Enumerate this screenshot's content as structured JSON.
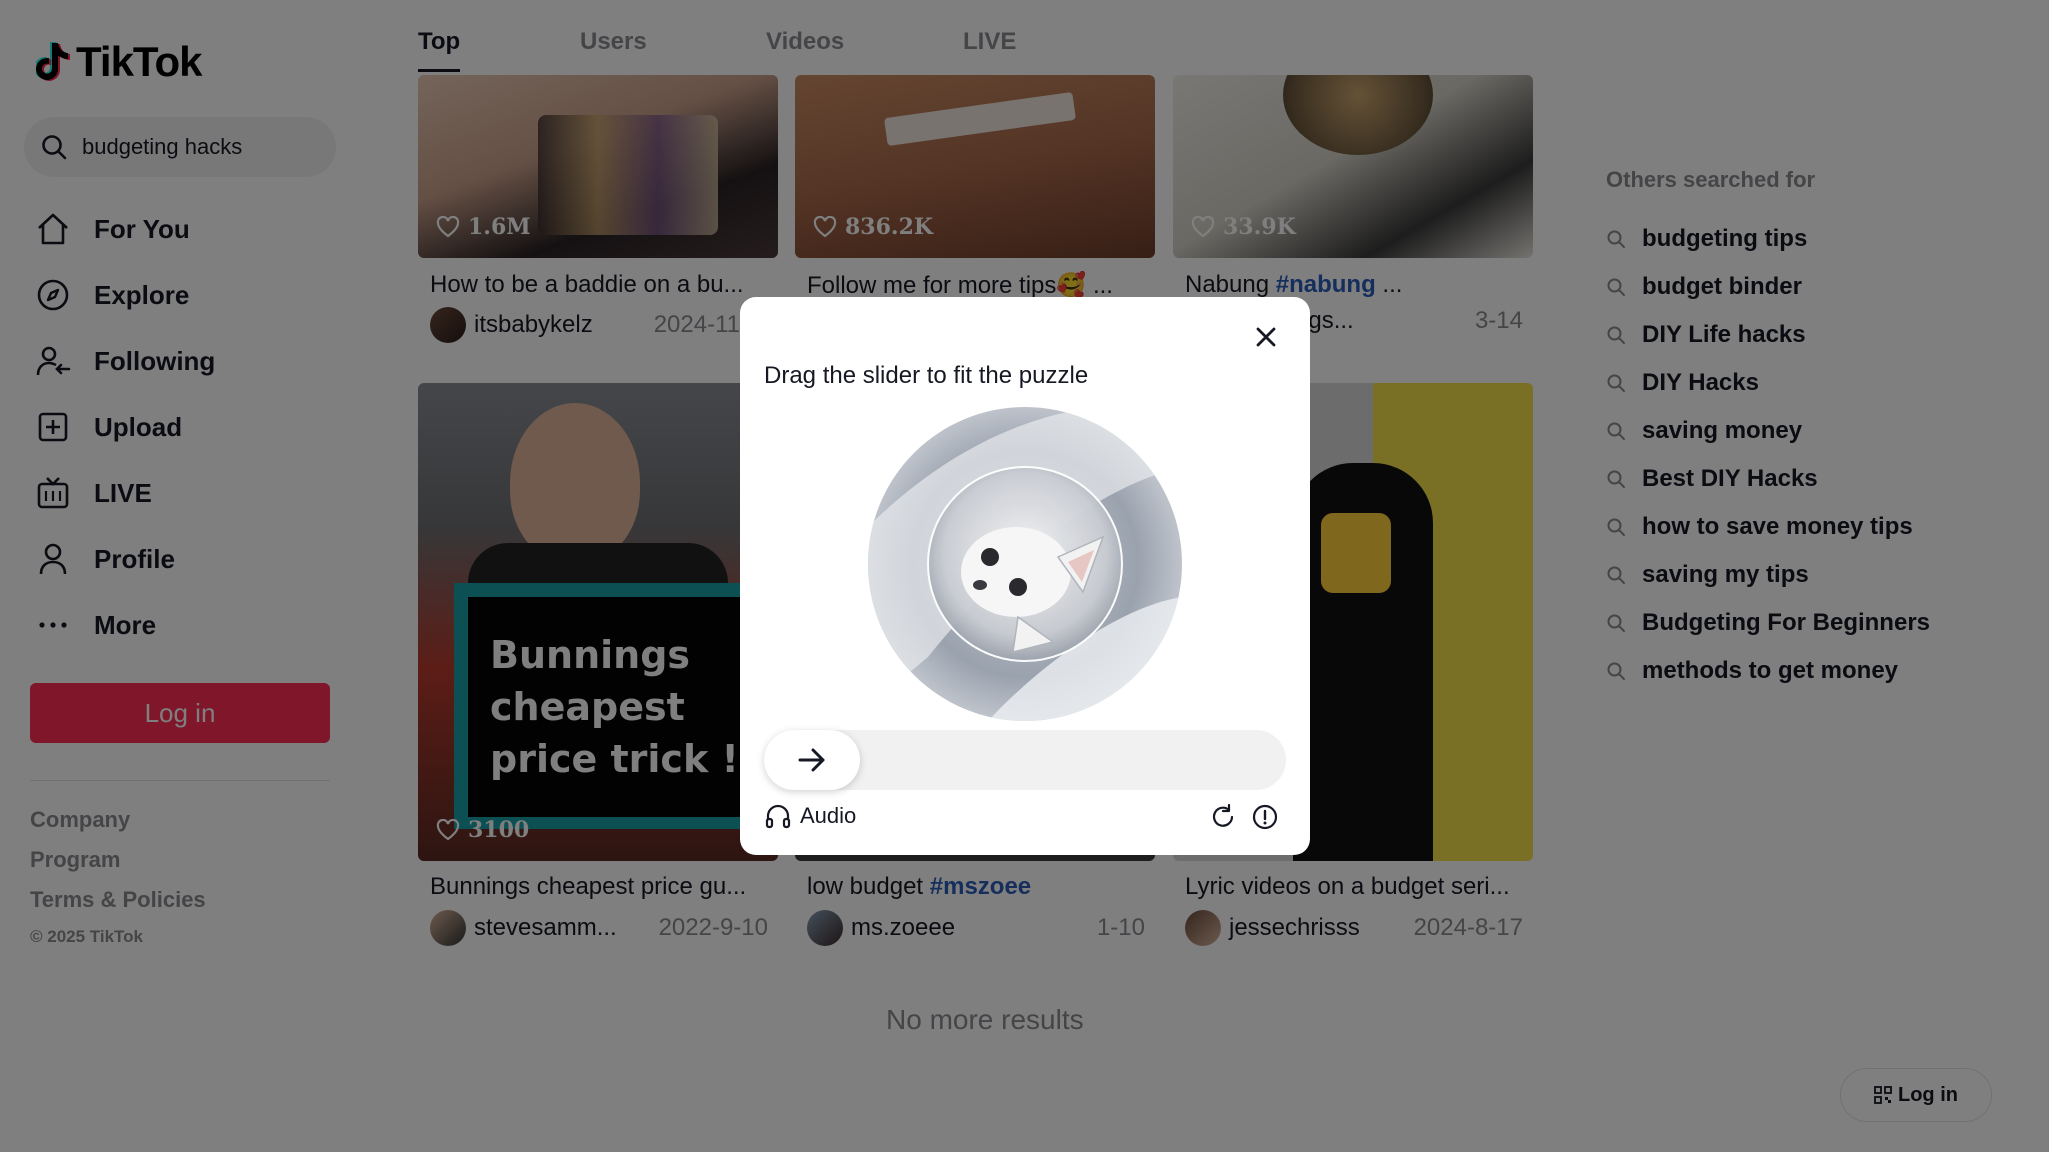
{
  "app": {
    "name": "TikTok"
  },
  "search": {
    "value": "budgeting hacks"
  },
  "nav": [
    {
      "label": "For You",
      "icon": "home-icon"
    },
    {
      "label": "Explore",
      "icon": "compass-icon"
    },
    {
      "label": "Following",
      "icon": "following-icon"
    },
    {
      "label": "Upload",
      "icon": "upload-icon"
    },
    {
      "label": "LIVE",
      "icon": "live-icon"
    },
    {
      "label": "Profile",
      "icon": "profile-icon"
    },
    {
      "label": "More",
      "icon": "more-icon"
    }
  ],
  "login_label": "Log in",
  "footer": {
    "links": [
      "Company",
      "Program",
      "Terms & Policies"
    ],
    "copyright": "© 2025 TikTok"
  },
  "tabs": [
    "Top",
    "Users",
    "Videos",
    "LIVE"
  ],
  "videos": [
    {
      "likes": "1.6M",
      "caption": "How to be a baddie on a bu...",
      "tag": "",
      "author": "itsbabykelz",
      "date": "2024-11-..."
    },
    {
      "likes": "836.2K",
      "caption": "Follow me for more tips🥰 ...",
      "tag": "",
      "author": "",
      "date": ""
    },
    {
      "likes": "33.9K",
      "caption": "Nabung ",
      "tag": "#nabung",
      "caption_tail": " ...",
      "author": "...ngs...",
      "date": "3-14"
    },
    {
      "likes": "3100",
      "caption": "Bunnings cheapest price gu...",
      "tag": "",
      "author": "stevesamm...",
      "date": "2022-9-10",
      "thumb_text": [
        "Bunnings",
        "cheapest",
        "price trick !"
      ]
    },
    {
      "likes": "",
      "caption": "low budget ",
      "tag": "#mszoee",
      "author": "ms.zoeee",
      "date": "1-10"
    },
    {
      "likes": "",
      "caption": "Lyric videos on a budget seri...",
      "tag": "",
      "author": "jessechrisss",
      "date": "2024-8-17"
    }
  ],
  "no_more": "No more results",
  "others": {
    "title": "Others searched for",
    "items": [
      "budgeting tips",
      "budget binder",
      "DIY Life hacks",
      "DIY Hacks",
      "saving money",
      "Best DIY Hacks",
      "how to save money tips",
      "saving my tips",
      "Budgeting For Beginners",
      "methods to get money"
    ]
  },
  "float_login": "Log in",
  "captcha": {
    "title": "Drag the slider to fit the puzzle",
    "audio_label": "Audio",
    "slider_progress": 0
  },
  "colors": {
    "accent": "#fe2c55",
    "hashtag": "#2b5db9",
    "muted": "#8a8b91"
  }
}
